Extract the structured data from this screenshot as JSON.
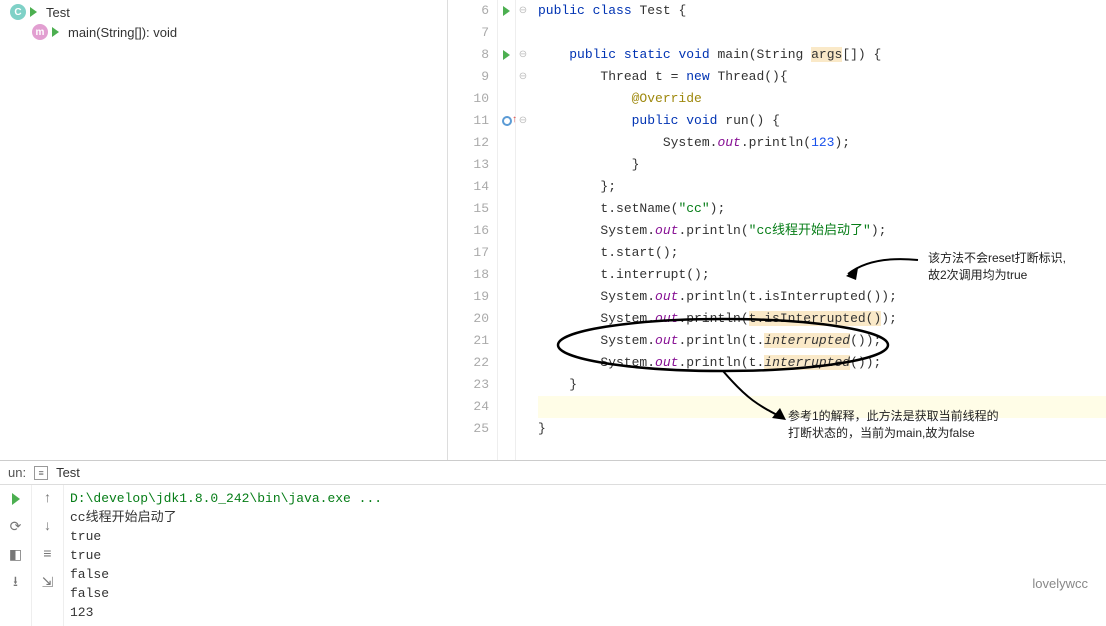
{
  "sidebar": {
    "class_name": "Test",
    "method_label": "main(String[]): void"
  },
  "editor": {
    "lines": [
      {
        "n": 6,
        "marker": "run",
        "fold": "⊖",
        "tokens": [
          [
            "kw",
            "public"
          ],
          [
            "",
            " "
          ],
          [
            "kw",
            "class"
          ],
          [
            "",
            " Test {"
          ]
        ]
      },
      {
        "n": 7,
        "marker": "",
        "fold": "",
        "tokens": [
          [
            "",
            ""
          ]
        ]
      },
      {
        "n": 8,
        "marker": "run",
        "fold": "⊖",
        "tokens": [
          [
            "",
            "    "
          ],
          [
            "kw",
            "public"
          ],
          [
            "",
            " "
          ],
          [
            "kw",
            "static"
          ],
          [
            "",
            " "
          ],
          [
            "kw",
            "void"
          ],
          [
            "",
            " main(String "
          ],
          [
            "hl",
            "args"
          ],
          [
            "",
            "[]) {"
          ]
        ]
      },
      {
        "n": 9,
        "marker": "",
        "fold": "⊖",
        "tokens": [
          [
            "",
            "        Thread t = "
          ],
          [
            "kw",
            "new"
          ],
          [
            "",
            " Thread(){"
          ]
        ]
      },
      {
        "n": 10,
        "marker": "",
        "fold": "",
        "tokens": [
          [
            "",
            "            "
          ],
          [
            "ann",
            "@Override"
          ]
        ]
      },
      {
        "n": 11,
        "marker": "ov",
        "fold": "⊖",
        "tokens": [
          [
            "",
            "            "
          ],
          [
            "kw",
            "public"
          ],
          [
            "",
            " "
          ],
          [
            "kw",
            "void"
          ],
          [
            "",
            " run() {"
          ]
        ]
      },
      {
        "n": 12,
        "marker": "",
        "fold": "",
        "tokens": [
          [
            "",
            "                System."
          ],
          [
            "fld",
            "out"
          ],
          [
            "",
            ".println("
          ],
          [
            "num",
            "123"
          ],
          [
            "",
            ");"
          ]
        ]
      },
      {
        "n": 13,
        "marker": "",
        "fold": "",
        "tokens": [
          [
            "",
            "            }"
          ]
        ]
      },
      {
        "n": 14,
        "marker": "",
        "fold": "",
        "tokens": [
          [
            "",
            "        };"
          ]
        ]
      },
      {
        "n": 15,
        "marker": "",
        "fold": "",
        "tokens": [
          [
            "",
            "        t.setName("
          ],
          [
            "str",
            "\"cc\""
          ],
          [
            "",
            ");"
          ]
        ]
      },
      {
        "n": 16,
        "marker": "",
        "fold": "",
        "tokens": [
          [
            "",
            "        System."
          ],
          [
            "fld",
            "out"
          ],
          [
            "",
            ".println("
          ],
          [
            "str",
            "\"cc线程开始启动了\""
          ],
          [
            "",
            ");"
          ]
        ]
      },
      {
        "n": 17,
        "marker": "",
        "fold": "",
        "tokens": [
          [
            "",
            "        t.start();"
          ]
        ]
      },
      {
        "n": 18,
        "marker": "",
        "fold": "",
        "tokens": [
          [
            "",
            "        t.interrupt();"
          ]
        ]
      },
      {
        "n": 19,
        "marker": "",
        "fold": "",
        "tokens": [
          [
            "",
            "        System."
          ],
          [
            "fld",
            "out"
          ],
          [
            "",
            ".println(t.isInterrupted());"
          ]
        ]
      },
      {
        "n": 20,
        "marker": "",
        "fold": "",
        "tokens": [
          [
            "",
            "        System."
          ],
          [
            "fld",
            "out"
          ],
          [
            "",
            ".println("
          ],
          [
            "hl",
            "t.isInterrupted()"
          ],
          [
            "",
            ");"
          ]
        ]
      },
      {
        "n": 21,
        "marker": "",
        "fold": "",
        "tokens": [
          [
            "",
            "        System."
          ],
          [
            "fld",
            "out"
          ],
          [
            "",
            ".println(t."
          ],
          [
            "hl it",
            "interrupted"
          ],
          [
            "",
            "());"
          ]
        ]
      },
      {
        "n": 22,
        "marker": "",
        "fold": "",
        "tokens": [
          [
            "",
            "        System."
          ],
          [
            "fld",
            "out"
          ],
          [
            "",
            ".println(t."
          ],
          [
            "hl it",
            "interrupted"
          ],
          [
            "",
            "());"
          ]
        ]
      },
      {
        "n": 23,
        "marker": "",
        "fold": "",
        "tokens": [
          [
            "",
            "    }"
          ]
        ]
      },
      {
        "n": 24,
        "marker": "",
        "fold": "",
        "tokens": [
          [
            "",
            ""
          ]
        ],
        "active": true
      },
      {
        "n": 25,
        "marker": "",
        "fold": "",
        "tokens": [
          [
            "",
            "}"
          ]
        ]
      }
    ]
  },
  "annotations": {
    "right1": "该方法不会reset打断标识,",
    "right2": "故2次调用均为true",
    "bottom1": "参考1的解释，此方法是获取当前线程的",
    "bottom2": "打断状态的，当前为main,故为false"
  },
  "run": {
    "prefix": "un:",
    "tab": "Test",
    "cmd": "D:\\develop\\jdk1.8.0_242\\bin\\java.exe ...",
    "out": [
      "cc线程开始启动了",
      "true",
      "true",
      "false",
      "false",
      "123"
    ]
  },
  "watermark": "lovelywcc"
}
